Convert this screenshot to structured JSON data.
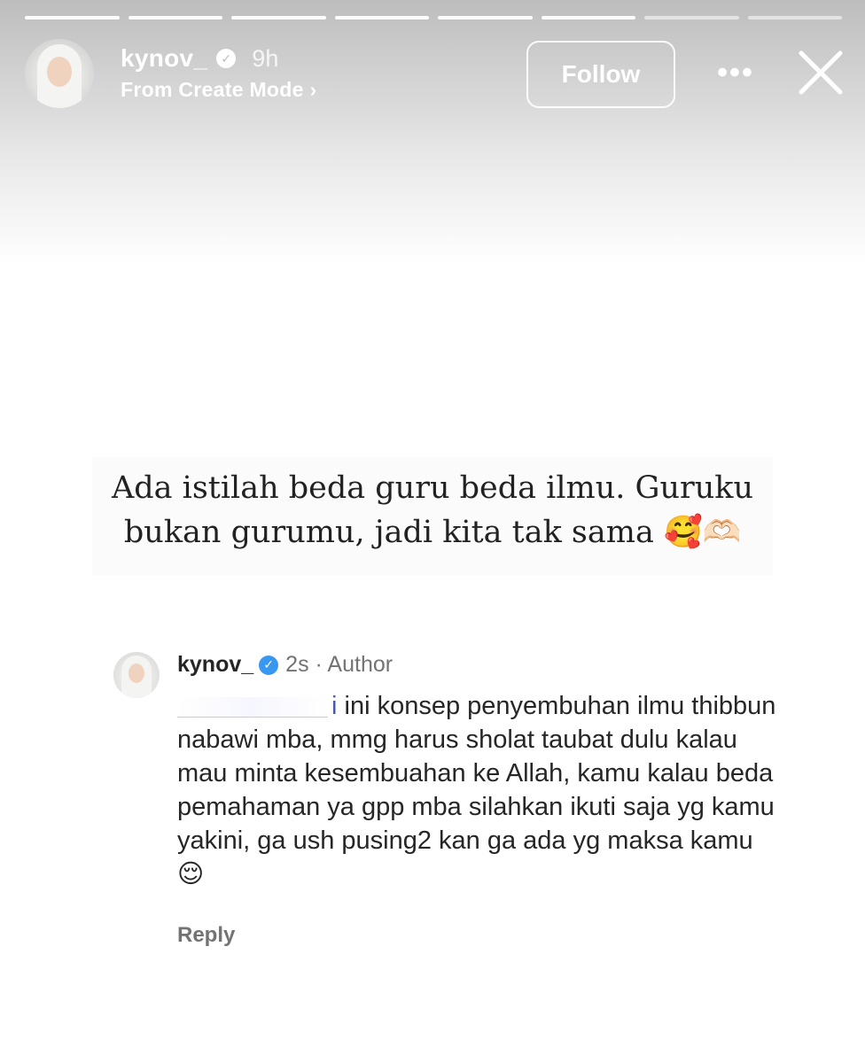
{
  "story": {
    "progress_segments": 8,
    "progress_done": 6,
    "header": {
      "username": "kynov_",
      "time": "9h",
      "subline": "From Create Mode",
      "follow_label": "Follow",
      "more_icon": "more-horizontal-icon",
      "close_icon": "close-icon"
    },
    "text_lines": [
      "Ada istilah beda guru beda ilmu. Guruku",
      "bukan gurumu, jadi kita tak sama 🥰🫶🏻"
    ]
  },
  "comment": {
    "username": "kynov_",
    "meta": "2s · Author",
    "mention_visible": "i",
    "body": "ini konsep penyembuhan ilmu thibbun nabawi mba, mmg harus sholat taubat dulu kalau mau minta kesembuahan ke Allah, kamu kalau beda pemahaman ya gpp mba silahkan ikuti saja yg kamu yakini, ga ush pusing2 kan ga ada yg maksa kamu",
    "emoji": "😌",
    "reply_label": "Reply"
  },
  "colors": {
    "header_gradient_top": "#bdbdbd",
    "verified_blue": "#3897f0",
    "muted_text": "#737373"
  }
}
